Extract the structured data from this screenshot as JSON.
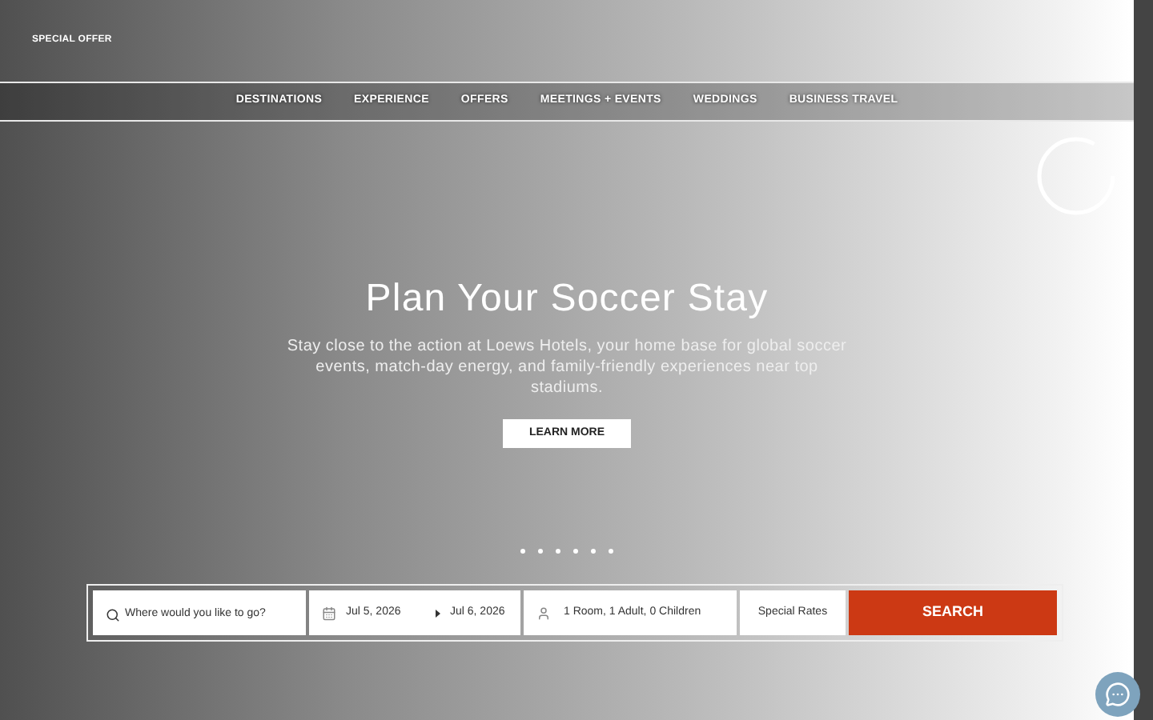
{
  "top_bar": {
    "promo_link": "SPECIAL OFFER"
  },
  "nav": {
    "items": [
      {
        "label": "DESTINATIONS"
      },
      {
        "label": "EXPERIENCE"
      },
      {
        "label": "OFFERS"
      },
      {
        "label": "MEETINGS + EVENTS"
      },
      {
        "label": "WEDDINGS"
      },
      {
        "label": "BUSINESS TRAVEL"
      }
    ]
  },
  "hero": {
    "title": "Plan Your Soccer Stay",
    "text": "Stay close to the action at Loews Hotels, your home base for global soccer events, match-day energy, and family-friendly experiences near top stadiums.",
    "button": "LEARN MORE",
    "dots": [
      {
        "selected": false
      },
      {
        "selected": false
      },
      {
        "selected": false
      },
      {
        "selected": false
      },
      {
        "selected": false
      },
      {
        "selected": false
      }
    ]
  },
  "booking": {
    "destination": {
      "placeholder": "Where would you like to go?"
    },
    "check_in": "Jul 5, 2026",
    "check_out": "Jul 6, 2026",
    "guests": "1 Room, 1 Adult, 0 Children",
    "rates": "Special Rates",
    "search_button": "SEARCH"
  }
}
